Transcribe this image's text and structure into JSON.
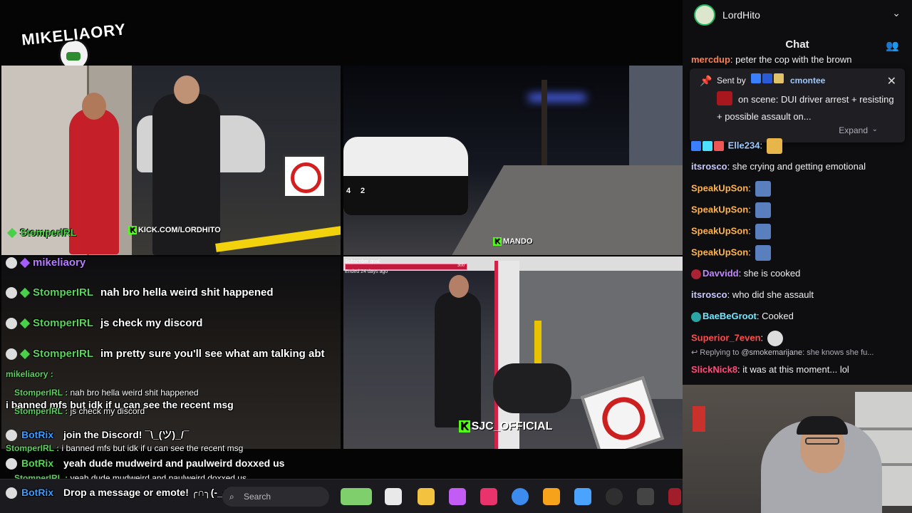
{
  "logo": {
    "text": "MIKELIAORY"
  },
  "panels": {
    "p1": {
      "streamer": "StomperIRL",
      "kick": "KICK.COM/LORDHITO"
    },
    "p2": {
      "kick": "MANDO",
      "counters": [
        "4",
        "2"
      ]
    },
    "p4": {
      "goal_label": "Subscriber goal:",
      "goal_count": "300",
      "ended": "Ended 24 days ago",
      "kick": "SJC_OFFICIAL"
    }
  },
  "stream_chat": [
    {
      "name": "mikeliaory",
      "msg": "",
      "color": "purple"
    },
    {
      "name": "StomperIRL",
      "msg": "nah bro hella weird shit happened",
      "color": "green"
    },
    {
      "name": "StomperIRL",
      "msg": "js check my discord",
      "color": "green"
    },
    {
      "name": "StomperIRL",
      "msg": "im pretty sure you'll see what am talking abt",
      "color": "green"
    }
  ],
  "stream_chat_small": [
    {
      "name": "mikeliaory :",
      "msg": ""
    },
    {
      "name": "StomperIRL :",
      "msg": "nah bro hella weird shit happened"
    },
    {
      "name": "",
      "msg": "i banned mfs but idk if u can see the recent msg"
    },
    {
      "name": "StomperIRL :",
      "msg": "js check my discord"
    },
    {
      "name": "BotRix",
      "msg": "join the Discord! ¯\\_(ツ)_/¯"
    },
    {
      "name": "StomperIRL :",
      "msg": "i banned mfs but idk if u can see the recent msg"
    },
    {
      "name": "BotRix",
      "msg": "yeah dude mudweird and paulweird doxxed us"
    },
    {
      "name": "StomperIRL :",
      "msg": "yeah dude mudweird and paulweird doxxed us"
    },
    {
      "name": "BotRix",
      "msg": "Drop a message or emote! ╭∩╮(-_-)╭∩╮"
    }
  ],
  "taskbar": {
    "search_placeholder": "Search",
    "message_hint": "Drop a message or emote!"
  },
  "sidebar": {
    "user": "LordHito",
    "chat_title": "Chat",
    "cut_message": {
      "name": "mercdup",
      "text": ": peter the cop with the brown"
    },
    "pinned": {
      "sent_by_label": "Sent by",
      "sender": "cmontee",
      "text": "on scene: DUI driver arrest + resisting + possible assault on...",
      "expand_label": "Expand"
    },
    "messages": [
      {
        "name": "Elle234",
        "text": ":",
        "color": "#9ec9ff"
      },
      {
        "name": "itsrosco",
        "text": ": she crying and getting emotional",
        "color": "#c8c8ff"
      },
      {
        "name": "SpeakUpSon",
        "text": ":",
        "color": "#ffb347"
      },
      {
        "name": "SpeakUpSon",
        "text": ":",
        "color": "#ffb347"
      },
      {
        "name": "SpeakUpSon",
        "text": ":",
        "color": "#ffb347"
      },
      {
        "name": "SpeakUpSon",
        "text": ":",
        "color": "#ffb347"
      },
      {
        "name": "Davvidd",
        "text": ": she is cooked",
        "color": "#c287ff"
      },
      {
        "name": "itsrosco",
        "text": ": who did she assault",
        "color": "#c8c8ff"
      },
      {
        "name": "BaeBeGroot",
        "text": ": Cooked",
        "color": "#6ee7ff"
      },
      {
        "name": "Superior_7even",
        "text": ":",
        "color": "#ff4b4b"
      },
      {
        "name": "SlickNick8",
        "text": ": it was at this moment... lol",
        "color": "#ff4b7a"
      }
    ],
    "reply": {
      "prefix": "Replying to",
      "target": "@smokemarijane",
      "text": ": she knows she fu..."
    }
  },
  "colors": {
    "accent": "#27c24c",
    "chat_bg": "#0e0e10",
    "kick_green": "#53fc18"
  }
}
